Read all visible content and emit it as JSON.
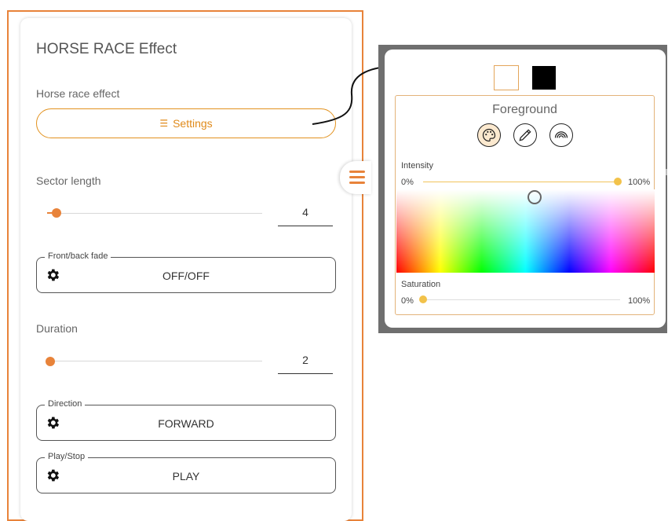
{
  "panel": {
    "title": "HORSE RACE Effect",
    "effect_label": "Horse race effect",
    "settings_button": "Settings",
    "sector_length": {
      "label": "Sector length",
      "value": "4",
      "slider_fraction": 0.05
    },
    "front_back_fade": {
      "legend": "Front/back fade",
      "value": "OFF/OFF"
    },
    "duration": {
      "label": "Duration",
      "value": "2",
      "slider_fraction": 0.0
    },
    "direction": {
      "legend": "Direction",
      "value": "FORWARD"
    },
    "play_stop": {
      "legend": "Play/Stop",
      "value": "PLAY"
    }
  },
  "color_picker": {
    "title": "Foreground",
    "intensity": {
      "label": "Intensity",
      "min_label": "0%",
      "max_label": "100%",
      "value_fraction": 1.0
    },
    "saturation": {
      "label": "Saturation",
      "min_label": "0%",
      "max_label": "100%",
      "value_fraction": 0.0
    },
    "foreground_swatch_color": "#ffffff",
    "background_swatch_color": "#000000",
    "modes": [
      "palette-icon",
      "eyedropper-icon",
      "rainbow-icon"
    ]
  },
  "colors": {
    "accent": "#e8833a",
    "picker_accent": "#f2c24a"
  }
}
